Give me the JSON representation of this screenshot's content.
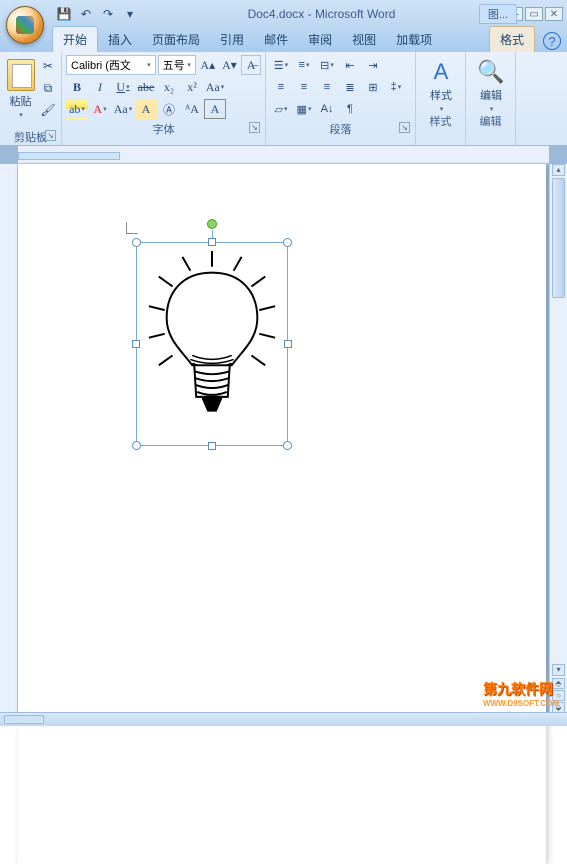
{
  "title": "Doc4.docx - Microsoft Word",
  "context_tab": "图...",
  "qat": {
    "save": "💾",
    "undo": "↶",
    "redo": "↷",
    "more": "▾"
  },
  "tabs": {
    "home": "开始",
    "insert": "插入",
    "layout": "页面布局",
    "refs": "引用",
    "mail": "邮件",
    "review": "审阅",
    "view": "视图",
    "addins": "加载项",
    "format": "格式"
  },
  "groups": {
    "clipboard": "剪贴板",
    "font": "字体",
    "paragraph": "段落",
    "styles": "样式",
    "editing": "编辑"
  },
  "paste_label": "粘贴",
  "font_name": "Calibri (西文",
  "font_size": "五号",
  "styles_label": "样式",
  "editing_label": "编辑",
  "watermark": "第九软件网",
  "watermark_sub": "WWW.D9SOFT.COM"
}
